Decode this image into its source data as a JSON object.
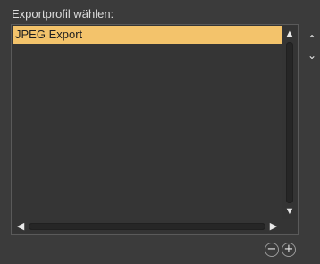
{
  "panel": {
    "label": "Exportprofil wählen:"
  },
  "list": {
    "items": [
      {
        "label": "JPEG Export",
        "selected": true
      }
    ]
  },
  "icons": {
    "scroll_up": "▲",
    "scroll_down": "▼",
    "scroll_left": "◀",
    "scroll_right": "▶",
    "move_up": "⌃",
    "move_down": "⌄",
    "remove": "−",
    "add": "+"
  },
  "colors": {
    "background": "#3b3b3b",
    "selection": "#f3c36b",
    "selection_text": "#202020",
    "text": "#dcdcdc"
  }
}
